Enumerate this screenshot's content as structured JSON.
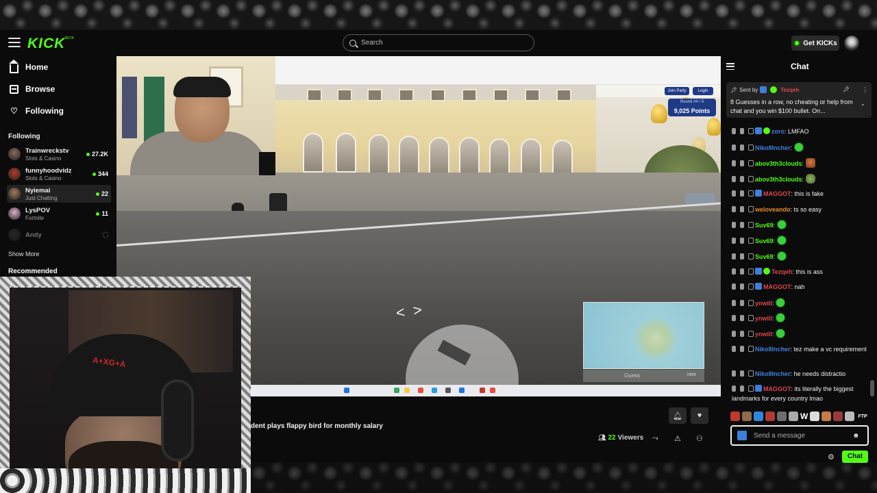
{
  "brand": {
    "logo": "KICK",
    "beta": "BETA",
    "accent": "#53fc18"
  },
  "header": {
    "search_placeholder": "Search",
    "get_kicks_label": "Get KICKs"
  },
  "nav": [
    {
      "label": "Home",
      "icon": "home-icon"
    },
    {
      "label": "Browse",
      "icon": "browse-icon"
    },
    {
      "label": "Following",
      "icon": "heart-icon"
    }
  ],
  "following": {
    "title": "Following",
    "channels": [
      {
        "name": "Trainwreckstv",
        "category": "Slots & Casino",
        "viewers": "27.2K",
        "live": true,
        "avatar_color": "#8a6b58"
      },
      {
        "name": "funnyhoodvidz",
        "category": "Slots & Casino",
        "viewers": "344",
        "live": true,
        "avatar_color": "#b33a2b"
      },
      {
        "name": "Nyiemai",
        "category": "Just Chatting",
        "viewers": "22",
        "live": true,
        "avatar_color": "#9e7a5c"
      },
      {
        "name": "LysPOV",
        "category": "Fortnite",
        "viewers": "11",
        "live": true,
        "avatar_color": "#e0b0c8"
      },
      {
        "name": "Andy",
        "category": "",
        "viewers": "",
        "live": false,
        "avatar_color": "#4a4a4a"
      }
    ],
    "show_more": "Show More"
  },
  "recommended_title": "Recommended",
  "stream": {
    "title": "dent plays flappy bird for monthly salary",
    "viewers_count": "22",
    "viewers_label": "Viewers",
    "game_overlay": {
      "round": "Round #4 / 5",
      "points": "9,025 Points",
      "join_party": "Join Party",
      "login": "Login",
      "guess": "Guess",
      "hint": "Hint"
    },
    "hat_text": "A+XG+A"
  },
  "chat": {
    "title": "Chat",
    "pinned": {
      "sent_by_label": "Sent by",
      "user": "Tezqeh",
      "text": "8 Guesses in a row, no cheating or help from chat and you win $100 bullet. On..."
    },
    "messages": [
      {
        "user": "zoro",
        "color": "#3f7fdc",
        "badges": [
          "blue",
          "green"
        ],
        "text": "LMFAO",
        "emote": ""
      },
      {
        "user": "Niko8Incher",
        "color": "#3f7fdc",
        "badges": [],
        "text": "",
        "emote": "green"
      },
      {
        "user": "abov3th3clouds",
        "color": "#53fc18",
        "badges": [],
        "text": "",
        "emote": "face"
      },
      {
        "user": "abov3th3clouds",
        "color": "#53fc18",
        "badges": [],
        "text": "",
        "emote": "frog"
      },
      {
        "user": "MAGGOT",
        "color": "#e0464b",
        "badges": [
          "blue"
        ],
        "text": "this is fake",
        "emote": ""
      },
      {
        "user": "weloveando",
        "color": "#e58a2c",
        "badges": [],
        "text": "ts so easy",
        "emote": ""
      },
      {
        "user": "Suv69",
        "color": "#53fc18",
        "badges": [],
        "text": "",
        "emote": "green"
      },
      {
        "user": "Suv69",
        "color": "#53fc18",
        "badges": [],
        "text": "",
        "emote": "green"
      },
      {
        "user": "Suv69",
        "color": "#53fc18",
        "badges": [],
        "text": "",
        "emote": "green"
      },
      {
        "user": "Tezqeh",
        "color": "#e0464b",
        "badges": [
          "blue",
          "green"
        ],
        "text": "this is ass",
        "emote": ""
      },
      {
        "user": "MAGGOT",
        "color": "#e0464b",
        "badges": [
          "blue"
        ],
        "text": "nah",
        "emote": ""
      },
      {
        "user": "ynwill",
        "color": "#e0464b",
        "badges": [],
        "text": "",
        "emote": "green"
      },
      {
        "user": "ynwill",
        "color": "#e0464b",
        "badges": [],
        "text": "",
        "emote": "green"
      },
      {
        "user": "ynwill",
        "color": "#e0464b",
        "badges": [],
        "text": "",
        "emote": "green"
      },
      {
        "user": "Niko8Incher",
        "color": "#3f7fdc",
        "badges": [],
        "text": "tez make a vc requirement",
        "emote": ""
      },
      {
        "user": "Niko8Incher",
        "color": "#3f7fdc",
        "badges": [],
        "text": "he needs distractio",
        "emote": ""
      },
      {
        "user": "MAGGOT",
        "color": "#e0464b",
        "badges": [
          "blue"
        ],
        "text": "its literally the biggest landmarks for every country lmao",
        "emote": ""
      }
    ],
    "emote_bar_colors": [
      "#c0392b",
      "#8e6b4a",
      "#2e86de",
      "#b03a2e",
      "#6d6d6d",
      "#aaa",
      "#ddd",
      "#c47a4a",
      "#9a3b3b",
      "#bbb"
    ],
    "emote_bar_w": "W",
    "emote_bar_ftp": "FTP",
    "input_placeholder": "Send a message",
    "send_label": "Chat"
  }
}
